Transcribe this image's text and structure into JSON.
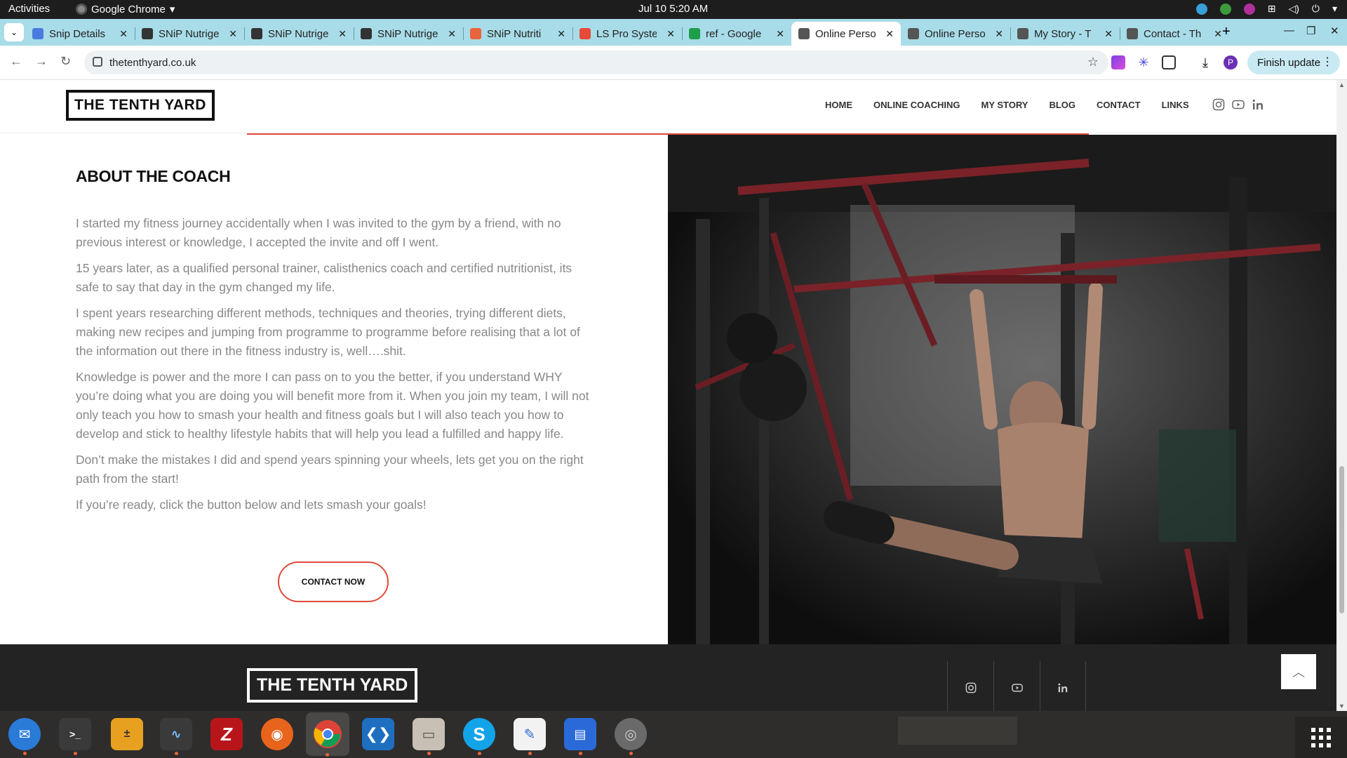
{
  "system": {
    "activities": "Activities",
    "app_name": "Google Chrome",
    "clock": "Jul 10  5:20 AM"
  },
  "tabs": [
    {
      "title": "Snip Details",
      "favicon_color": "#4a7bdc"
    },
    {
      "title": "SNiP Nutrige",
      "favicon_color": "#333333"
    },
    {
      "title": "SNiP Nutrige",
      "favicon_color": "#333333"
    },
    {
      "title": "SNiP Nutrige",
      "favicon_color": "#333333"
    },
    {
      "title": "SNiP Nutriti",
      "favicon_color": "#e8643c"
    },
    {
      "title": "LS Pro Syste",
      "favicon_color": "#e84a3a"
    },
    {
      "title": "ref - Google",
      "favicon_color": "#1e9e4a"
    },
    {
      "title": "Online Perso",
      "favicon_color": "#555555",
      "active": true
    },
    {
      "title": "Online Perso",
      "favicon_color": "#555555"
    },
    {
      "title": "My Story - T",
      "favicon_color": "#555555"
    },
    {
      "title": "Contact - Th",
      "favicon_color": "#555555"
    }
  ],
  "browser": {
    "url": "thetenthyard.co.uk",
    "finish_update": "Finish update",
    "profile_initial": "P"
  },
  "site": {
    "logo": "THE TENTH YARD",
    "nav": [
      "HOME",
      "ONLINE COACHING",
      "MY STORY",
      "BLOG",
      "CONTACT",
      "LINKS"
    ],
    "accent_color": "#e04a3a",
    "about": {
      "heading": "ABOUT THE COACH",
      "paragraphs": [
        "I started my fitness journey accidentally when I was invited to the gym by a friend, with no previous interest or knowledge, I accepted the invite and off I went.",
        "15 years later, as a qualified personal trainer, calisthenics coach and certified nutritionist, its safe to say that day in the gym changed my life.",
        "I spent years researching different methods, techniques and theories, trying different diets, making new recipes and jumping from programme to programme before realising that a lot of the information out there in the fitness industry is, well….shit.",
        "Knowledge is power and the more I can pass on to you the better, if you understand WHY you’re doing what you are doing you will benefit more from it. When you join my team, I will not only teach you how to smash your health and fitness goals but I will also teach you how to develop and stick to healthy lifestyle habits that will help you lead a fulfilled and happy life.",
        "Don’t make the mistakes I did and spend years spinning your wheels, lets get you on the right path from the start!",
        "If you’re ready, click the button below and lets smash your goals!"
      ],
      "button": "CONTACT NOW"
    },
    "footer_logo": "THE TENTH YARD"
  },
  "dock": [
    "thunderbird",
    "terminal",
    "calculator",
    "system-monitor",
    "filezilla",
    "firefox",
    "chrome",
    "vscode",
    "files",
    "skype",
    "text-editor",
    "document-viewer",
    "disks"
  ]
}
